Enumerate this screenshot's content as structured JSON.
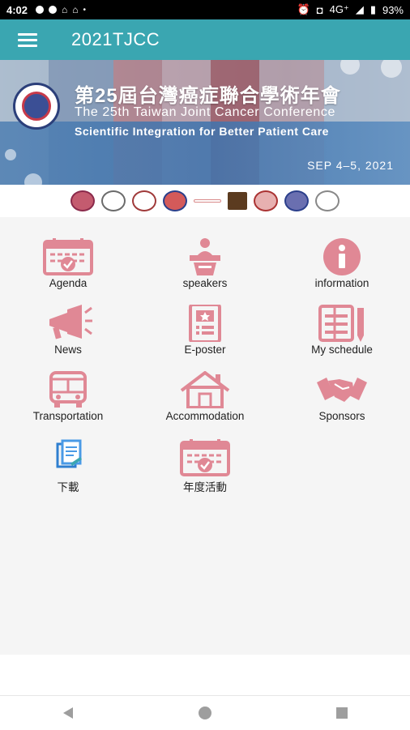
{
  "status": {
    "time": "4:02",
    "network": "4G⁺",
    "battery": "93%"
  },
  "app": {
    "title": "2021TJCC"
  },
  "banner": {
    "title_zh": "第25屆台灣癌症聯合學術年會",
    "title_en": "The 25th Taiwan Joint Cancer Conference",
    "subtitle": "Scientific Integration for Better Patient Care",
    "date": "SEP 4–5, 2021"
  },
  "menu": [
    {
      "label": "Agenda",
      "icon": "calendar-check-icon"
    },
    {
      "label": "speakers",
      "icon": "podium-speaker-icon"
    },
    {
      "label": "information",
      "icon": "info-icon"
    },
    {
      "label": "News",
      "icon": "megaphone-icon"
    },
    {
      "label": "E-poster",
      "icon": "poster-icon"
    },
    {
      "label": "My schedule",
      "icon": "notebook-pen-icon"
    },
    {
      "label": "Transportation",
      "icon": "bus-icon"
    },
    {
      "label": "Accommodation",
      "icon": "house-icon"
    },
    {
      "label": "Sponsors",
      "icon": "handshake-icon"
    },
    {
      "label": "下載",
      "icon": "download-document-icon"
    },
    {
      "label": "年度活動",
      "icon": "calendar-check-icon"
    }
  ],
  "colors": {
    "appbar": "#3aa6b1",
    "icon": "#e08895"
  }
}
